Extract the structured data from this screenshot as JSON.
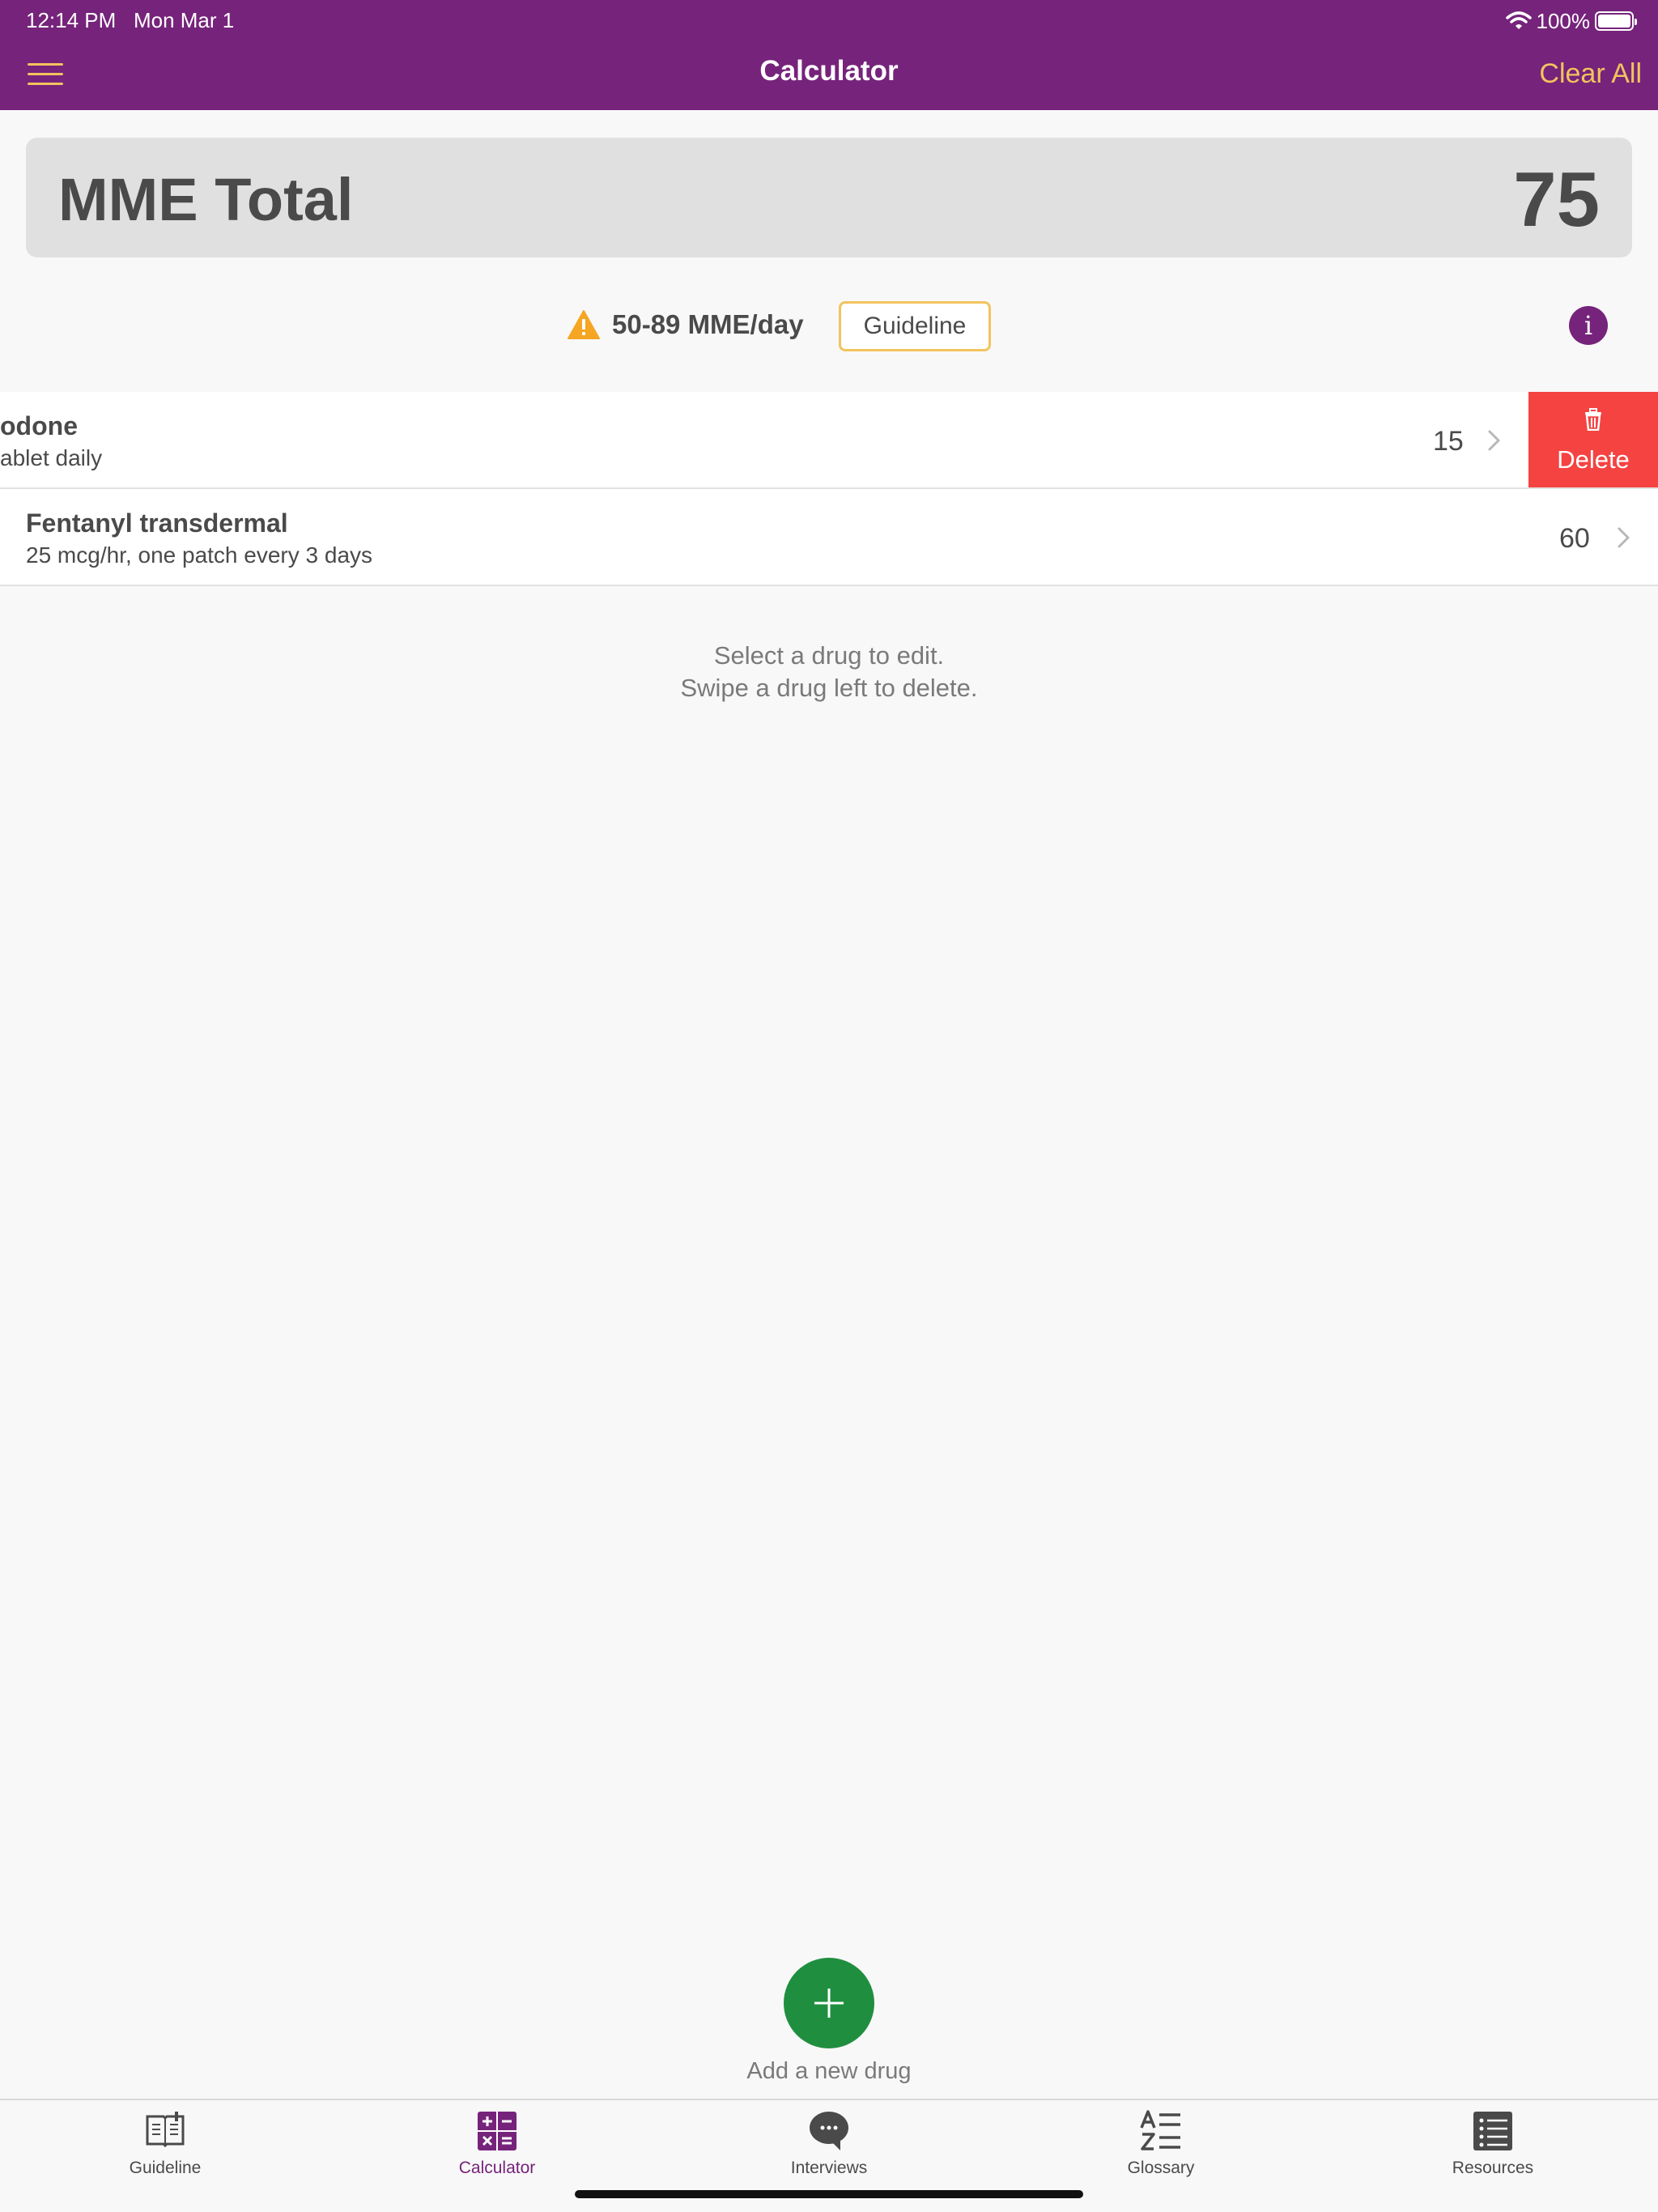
{
  "status_bar": {
    "time": "12:14 PM",
    "date": "Mon Mar 1",
    "battery": "100%"
  },
  "nav": {
    "title": "Calculator",
    "clear_all": "Clear All"
  },
  "total": {
    "label": "MME Total",
    "value": "75"
  },
  "risk": {
    "range": "50-89 MME/day",
    "guideline_button": "Guideline",
    "info": "i"
  },
  "drugs": [
    {
      "name": "odone",
      "desc": "ablet daily",
      "mme": "15",
      "delete_label": "Delete"
    },
    {
      "name": "Fentanyl transdermal",
      "desc": "25 mcg/hr, one patch every 3 days",
      "mme": "60"
    }
  ],
  "hints": {
    "line1": "Select a drug to edit.",
    "line2": "Swipe a drug left to delete."
  },
  "add": {
    "label": "Add a new drug"
  },
  "tabs": [
    {
      "label": "Guideline",
      "icon": "book-icon",
      "active": false
    },
    {
      "label": "Calculator",
      "icon": "calculator-icon",
      "active": true
    },
    {
      "label": "Interviews",
      "icon": "chat-bubble-icon",
      "active": false
    },
    {
      "label": "Glossary",
      "icon": "a-z-list-icon",
      "active": false
    },
    {
      "label": "Resources",
      "icon": "list-icon",
      "active": false
    }
  ],
  "colors": {
    "brand_purple": "#76237b",
    "accent_yellow": "#f2c35e",
    "delete_red": "#f54342",
    "add_green": "#1f8f3f",
    "warning_orange": "#f5a623"
  }
}
